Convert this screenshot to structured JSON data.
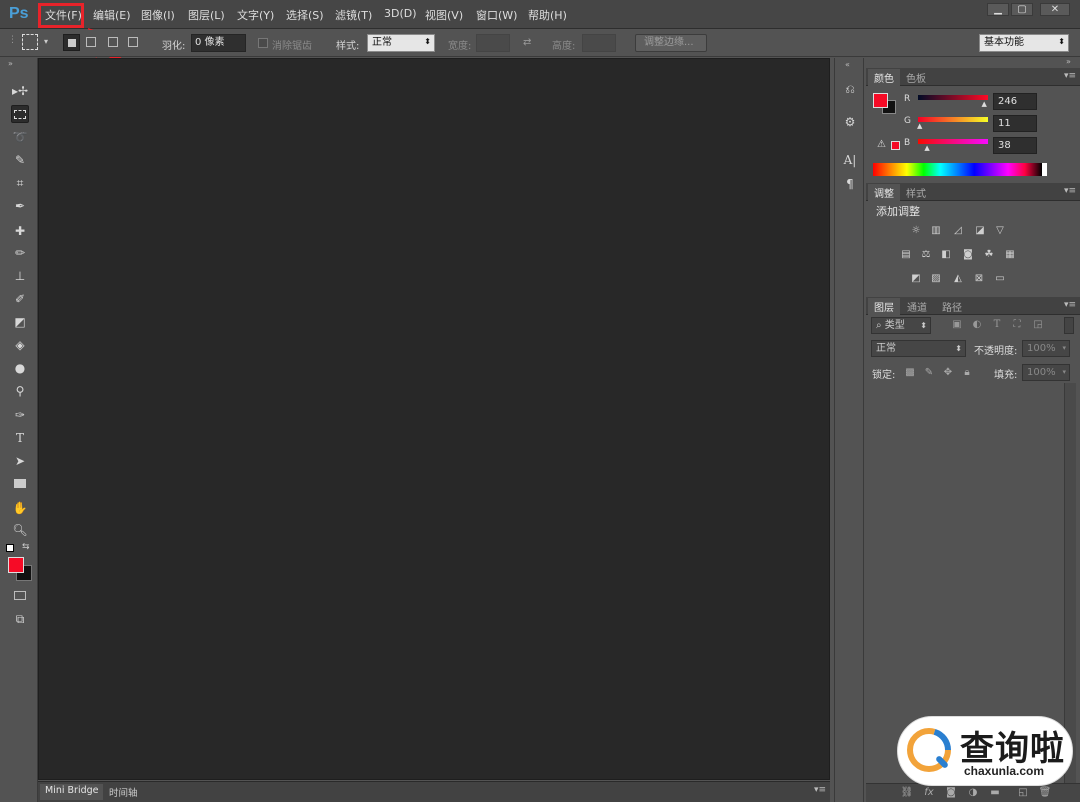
{
  "app": {
    "logo": "Ps"
  },
  "menu": [
    "文件(F)",
    "编辑(E)",
    "图像(I)",
    "图层(L)",
    "文字(Y)",
    "选择(S)",
    "滤镜(T)",
    "3D(D)",
    "视图(V)",
    "窗口(W)",
    "帮助(H)"
  ],
  "window_buttons": {
    "minimize": "▁",
    "maximize": "▢",
    "close": "✕"
  },
  "options": {
    "feather_label": "羽化:",
    "feather_value": "0 像素",
    "antialias_label": "消除锯齿",
    "style_label": "样式:",
    "style_value": "正常",
    "width_label": "宽度:",
    "height_label": "高度:",
    "refine_edge": "调整边缘...",
    "workspace": "基本功能"
  },
  "bottom_tabs": [
    "Mini Bridge",
    "时间轴"
  ],
  "color_panel": {
    "tabs": [
      "颜色",
      "色板"
    ],
    "r_label": "R",
    "g_label": "G",
    "b_label": "B",
    "r": "246",
    "g": "11",
    "b": "38",
    "r_fraction": 0.965,
    "g_fraction": 0.043,
    "b_fraction": 0.149,
    "foreground": "#f60b26",
    "background": "#111111"
  },
  "adjust_panel": {
    "tabs": [
      "调整",
      "样式"
    ],
    "heading": "添加调整"
  },
  "layers_panel": {
    "tabs": [
      "图层",
      "通道",
      "路径"
    ],
    "filter": "类型",
    "blend_mode": "正常",
    "opacity_label": "不透明度:",
    "opacity_value": "100%",
    "lock_label": "锁定:",
    "fill_label": "填充:",
    "fill_value": "100%"
  },
  "watermark": {
    "title": "查询啦",
    "url": "chaxunla.com"
  },
  "colors": {
    "highlight": "#e8232a",
    "accent": "#4a9fd8"
  }
}
